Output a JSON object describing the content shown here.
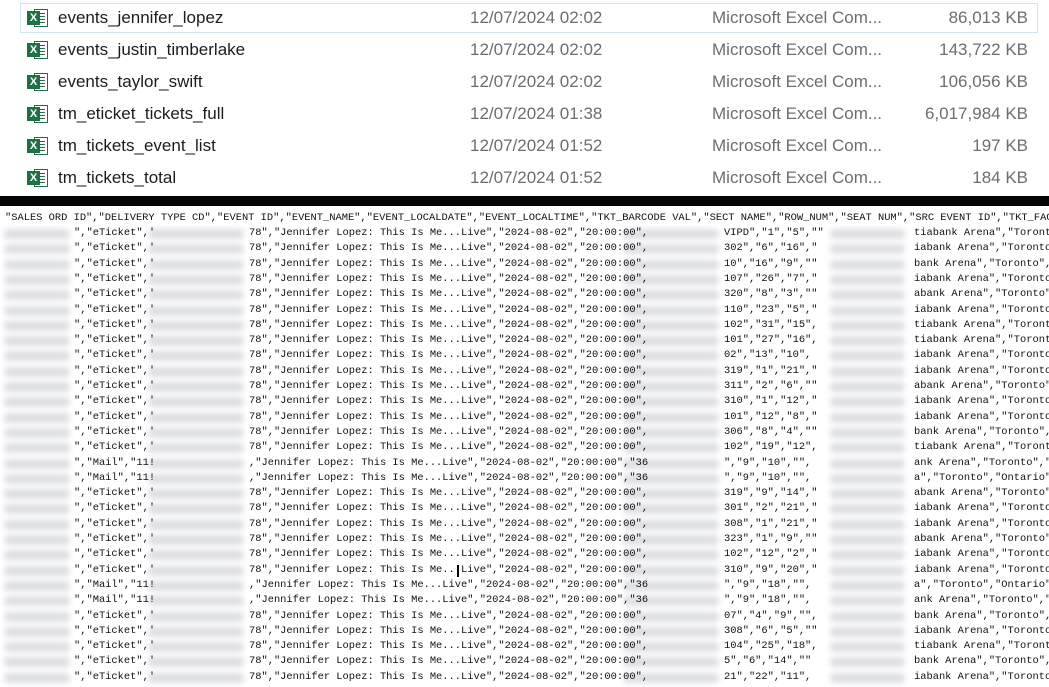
{
  "files": [
    {
      "name": "events_jennifer_lopez",
      "date": "12/07/2024 02:02",
      "type": "Microsoft Excel Com...",
      "size": "86,013 KB",
      "selected": true
    },
    {
      "name": "events_justin_timberlake",
      "date": "12/07/2024 02:02",
      "type": "Microsoft Excel Com...",
      "size": "143,722 KB"
    },
    {
      "name": "events_taylor_swift",
      "date": "12/07/2024 02:02",
      "type": "Microsoft Excel Com...",
      "size": "106,056 KB"
    },
    {
      "name": "tm_eticket_tickets_full",
      "date": "12/07/2024 01:38",
      "type": "Microsoft Excel Com...",
      "size": "6,017,984 KB"
    },
    {
      "name": "tm_tickets_event_list",
      "date": "12/07/2024 01:52",
      "type": "Microsoft Excel Com...",
      "size": "197 KB"
    },
    {
      "name": "tm_tickets_total",
      "date": "12/07/2024 01:52",
      "type": "Microsoft Excel Com...",
      "size": "184 KB"
    }
  ],
  "icon": {
    "name": "excel-file-icon",
    "badge": "X",
    "color": "#1e7145"
  },
  "csv": {
    "header": "\"SALES ORD ID\",\"DELIVERY TYPE CD\",\"EVENT ID\",\"EVENT_NAME\",\"EVENT_LOCALDATE\",\"EVENT_LOCALTIME\",\"TKT_BARCODE VAL\",\"SECT NAME\",\"ROW_NUM\",\"SEAT NUM\",\"SRC EVENT ID\",\"TKT_FACE_VAL_AMT\",\"",
    "rows": [
      {
        "type": "\",\"eTicket\",'",
        "event": "78\",\"Jennifer Lopez: This Is Me...Live\",\"2024-08-02\",\"20:00:00\",",
        "section": "VIPD\",\"1\",\"5\",\"\"",
        "venue": "tiabank Arena\",\"Toronto\""
      },
      {
        "type": "\",\"eTicket\",'",
        "event": "78\",\"Jennifer Lopez: This Is Me...Live\",\"2024-08-02\",\"20:00:00\",",
        "section": "302\",\"6\",\"16\",\"",
        "venue": "iabank Arena\",\"Toronto\""
      },
      {
        "type": "\",\"eTicket\",'",
        "event": "78\",\"Jennifer Lopez: This Is Me...Live\",\"2024-08-02\",\"20:00:00\",",
        "section": "10\",\"16\",\"9\",\"\"",
        "venue": "bank Arena\",\"Toronto\","
      },
      {
        "type": "\",\"eTicket\",'",
        "event": "78\",\"Jennifer Lopez: This Is Me...Live\",\"2024-08-02\",\"20:00:00\",",
        "section": "107\",\"26\",\"7\",\"",
        "venue": "iabank Arena\",\"Toronto\""
      },
      {
        "type": "\",\"eTicket\",'",
        "event": "78\",\"Jennifer Lopez: This Is Me...Live\",\"2024-08-02\",\"20:00:00\",",
        "section": "320\",\"8\",\"3\",\"\"",
        "venue": "abank Arena\",\"Toronto\","
      },
      {
        "type": "\",\"eTicket\",'",
        "event": "78\",\"Jennifer Lopez: This Is Me...Live\",\"2024-08-02\",\"20:00:00\",",
        "section": "110\",\"23\",\"5\",\"",
        "venue": "iabank Arena\",\"Toronto\""
      },
      {
        "type": "\",\"eTicket\",'",
        "event": "78\",\"Jennifer Lopez: This Is Me...Live\",\"2024-08-02\",\"20:00:00\",",
        "section": "102\",\"31\",\"15\",",
        "venue": "tiabank Arena\",\"Toronto"
      },
      {
        "type": "\",\"eTicket\",'",
        "event": "78\",\"Jennifer Lopez: This Is Me...Live\",\"2024-08-02\",\"20:00:00\",",
        "section": "101\",\"27\",\"16\",",
        "venue": "tiabank Arena\",\"Toronto"
      },
      {
        "type": "\",\"eTicket\",'",
        "event": "78\",\"Jennifer Lopez: This Is Me...Live\",\"2024-08-02\",\"20:00:00\",",
        "section": "02\",\"13\",\"10\",",
        "venue": "iabank Arena\",\"Toronto\""
      },
      {
        "type": "\",\"eTicket\",'",
        "event": "78\",\"Jennifer Lopez: This Is Me...Live\",\"2024-08-02\",\"20:00:00\",",
        "section": "319\",\"1\",\"21\",\"",
        "venue": "iabank Arena\",\"Toronto\""
      },
      {
        "type": "\",\"eTicket\",'",
        "event": "78\",\"Jennifer Lopez: This Is Me...Live\",\"2024-08-02\",\"20:00:00\",",
        "section": "311\",\"2\",\"6\",\"\"",
        "venue": "abank Arena\",\"Toronto\","
      },
      {
        "type": "\",\"eTicket\",'",
        "event": "78\",\"Jennifer Lopez: This Is Me...Live\",\"2024-08-02\",\"20:00:00\",",
        "section": "310\",\"1\",\"12\",\"",
        "venue": "iabank Arena\",\"Toronto\""
      },
      {
        "type": "\",\"eTicket\",'",
        "event": "78\",\"Jennifer Lopez: This Is Me...Live\",\"2024-08-02\",\"20:00:00\",",
        "section": "101\",\"12\",\"8\",\"",
        "venue": "iabank Arena\",\"Toronto\""
      },
      {
        "type": "\",\"eTicket\",'",
        "event": "78\",\"Jennifer Lopez: This Is Me...Live\",\"2024-08-02\",\"20:00:00\",",
        "section": "306\",\"8\",\"4\",\"\"",
        "venue": "bank Arena\",\"Toronto\","
      },
      {
        "type": "\",\"eTicket\",'",
        "event": "78\",\"Jennifer Lopez: This Is Me...Live\",\"2024-08-02\",\"20:00:00\",",
        "section": "102\",\"19\",\"12\",",
        "venue": "tiabank Arena\",\"Toronto"
      },
      {
        "type": "\",\"Mail\",\"11!",
        "event": ",\"Jennifer Lopez: This Is Me...Live\",\"2024-08-02\",\"20:00:00\",\"36",
        "section": "\",\"9\",\"10\",\"\",",
        "venue": "ank Arena\",\"Toronto\",\"C"
      },
      {
        "type": "\",\"Mail\",\"11!",
        "event": ",\"Jennifer Lopez: This Is Me...Live\",\"2024-08-02\",\"20:00:00\",\"36",
        "section": "\",\"9\",\"10\",\"\",",
        "venue": "a\",\"Toronto\",\"Ontario\","
      },
      {
        "type": "\",\"eTicket\",'",
        "event": "78\",\"Jennifer Lopez: This Is Me...Live\",\"2024-08-02\",\"20:00:00\",",
        "section": "319\",\"9\",\"14\",\"",
        "venue": "abank Arena\",\"Toronto\","
      },
      {
        "type": "\",\"eTicket\",'",
        "event": "78\",\"Jennifer Lopez: This Is Me...Live\",\"2024-08-02\",\"20:00:00\",",
        "section": "301\",\"2\",\"21\",\"",
        "venue": "iabank Arena\",\"Toronto\""
      },
      {
        "type": "\",\"eTicket\",'",
        "event": "78\",\"Jennifer Lopez: This Is Me...Live\",\"2024-08-02\",\"20:00:00\",",
        "section": "308\",\"1\",\"21\",\"",
        "venue": "iabank Arena\",\"Toronto\""
      },
      {
        "type": "\",\"eTicket\",'",
        "event": "78\",\"Jennifer Lopez: This Is Me...Live\",\"2024-08-02\",\"20:00:00\",",
        "section": "323\",\"1\",\"9\",\"\"",
        "venue": "abank Arena\",\"Toronto\","
      },
      {
        "type": "\",\"eTicket\",'",
        "event": "78\",\"Jennifer Lopez: This Is Me...Live\",\"2024-08-02\",\"20:00:00\",",
        "section": "102\",\"12\",\"2\",\"",
        "venue": "iabank Arena\",\"Toronto\""
      },
      {
        "type": "\",\"eTicket\",'",
        "event": "78\",\"Jennifer Lopez: This Is Me...Live\",\"2024-08-02\",\"20:00:00\",",
        "section": "310\",\"9\",\"20\",\"",
        "venue": "iabank Arena\",\"Toronto\""
      },
      {
        "type": "\",\"Mail\",\"11!",
        "event": ",\"Jennifer Lopez: This Is Me...Live\",\"2024-08-02\",\"20:00:00\",\"36",
        "section": "\",\"9\",\"18\",\"\",",
        "venue": "a\",\"Toronto\",\"Ontario\","
      },
      {
        "type": "\",\"Mail\",\"11!",
        "event": ",\"Jennifer Lopez: This Is Me...Live\",\"2024-08-02\",\"20:00:00\",\"36",
        "section": "\",\"9\",\"18\",\"\",",
        "venue": "ank Arena\",\"Toronto\",\"C"
      },
      {
        "type": "\",\"eTicket\",'",
        "event": "78\",\"Jennifer Lopez: This Is Me...Live\",\"2024-08-02\",\"20:00:00\",",
        "section": "07\",\"4\",\"9\",\"\",",
        "venue": "bank Arena\",\"Toronto\","
      },
      {
        "type": "\",\"eTicket\",'",
        "event": "78\",\"Jennifer Lopez: This Is Me...Live\",\"2024-08-02\",\"20:00:00\",",
        "section": "308\",\"6\",\"5\",\"\"",
        "venue": "iabank Arena\",\"Toronto\""
      },
      {
        "type": "\",\"eTicket\",'",
        "event": "78\",\"Jennifer Lopez: This Is Me...Live\",\"2024-08-02\",\"20:00:00\",",
        "section": "104\",\"25\",\"18\",",
        "venue": "tiabank Arena\",\"Toronto"
      },
      {
        "type": "\",\"eTicket\",'",
        "event": "78\",\"Jennifer Lopez: This Is Me...Live\",\"2024-08-02\",\"20:00:00\",",
        "section": "5\",\"6\",\"14\",\"\"",
        "venue": "bank Arena\",\"Toronto\","
      },
      {
        "type": "\",\"eTicket\",'",
        "event": "78\",\"Jennifer Lopez: This Is Me...Live\",\"2024-08-02\",\"20:00:00\",",
        "section": "21\",\"22\",\"11\",",
        "venue": "iabank Arena\",\"Toronto\""
      }
    ]
  }
}
